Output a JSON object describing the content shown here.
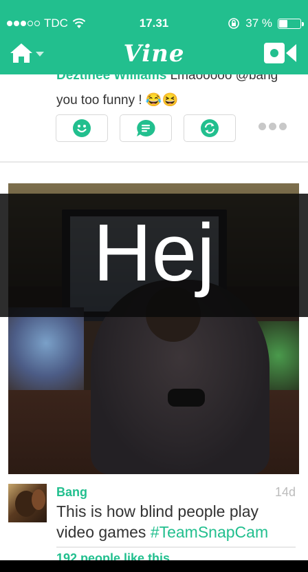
{
  "status_bar": {
    "carrier": "TDC",
    "time": "17.31",
    "battery": "37 %",
    "battery_level": 0.37,
    "signal_bars_filled": 3,
    "signal_bars_total": 5
  },
  "nav": {
    "logo": "Vine",
    "icons": [
      "home-icon",
      "chevron-down-icon",
      "camera-icon"
    ]
  },
  "previous_post": {
    "commenter": "Deztinee Williams",
    "comment_text": "Lmaooooo @bang you too funny ! 😂😆",
    "actions": [
      "smile-icon",
      "comment-icon",
      "revine-icon",
      "more-icon"
    ]
  },
  "post": {
    "author": "Bang",
    "age": "14d",
    "description": "This is how blind people play video games ",
    "hashtag": "#TeamSnapCam",
    "likes": "192 people like this"
  },
  "overlay": {
    "text": "Hej"
  },
  "colors": {
    "brand": "#22bf8e",
    "text": "#333333",
    "muted": "#bcbcbc"
  }
}
